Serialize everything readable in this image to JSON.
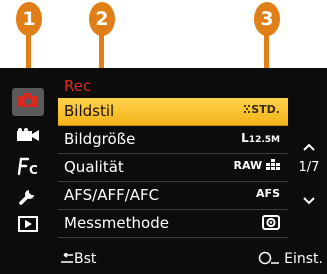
{
  "callouts": [
    {
      "number": "1",
      "color": "#e07f18"
    },
    {
      "number": "2",
      "color": "#e07f18"
    },
    {
      "number": "3",
      "color": "#e07f18"
    }
  ],
  "sidebar": {
    "items": [
      {
        "icon": "camera-icon",
        "active": true
      },
      {
        "icon": "video-camera-icon",
        "active": false
      },
      {
        "icon": "custom-settings-icon",
        "label": "C",
        "active": false
      },
      {
        "icon": "wrench-icon",
        "active": false
      },
      {
        "icon": "playback-icon",
        "active": false
      }
    ]
  },
  "menu": {
    "title": "Rec",
    "title_color": "#d82a20",
    "highlight_color": "#f3b31b",
    "rows": [
      {
        "label": "Bildstil",
        "value": "STD.",
        "selected": true
      },
      {
        "label": "Bildgröße",
        "value": "L",
        "value_sub": "12.5M",
        "selected": false
      },
      {
        "label": "Qualität",
        "value": "RAW",
        "selected": false
      },
      {
        "label": "AFS/AFF/AFC",
        "value": "AFS",
        "selected": false
      },
      {
        "label": "Messmethode",
        "value": "",
        "selected": false
      }
    ]
  },
  "pagination": {
    "current": "1",
    "total": "7",
    "text": "1/7"
  },
  "footer": {
    "back_label": "Bst",
    "settings_label": "Einst."
  }
}
